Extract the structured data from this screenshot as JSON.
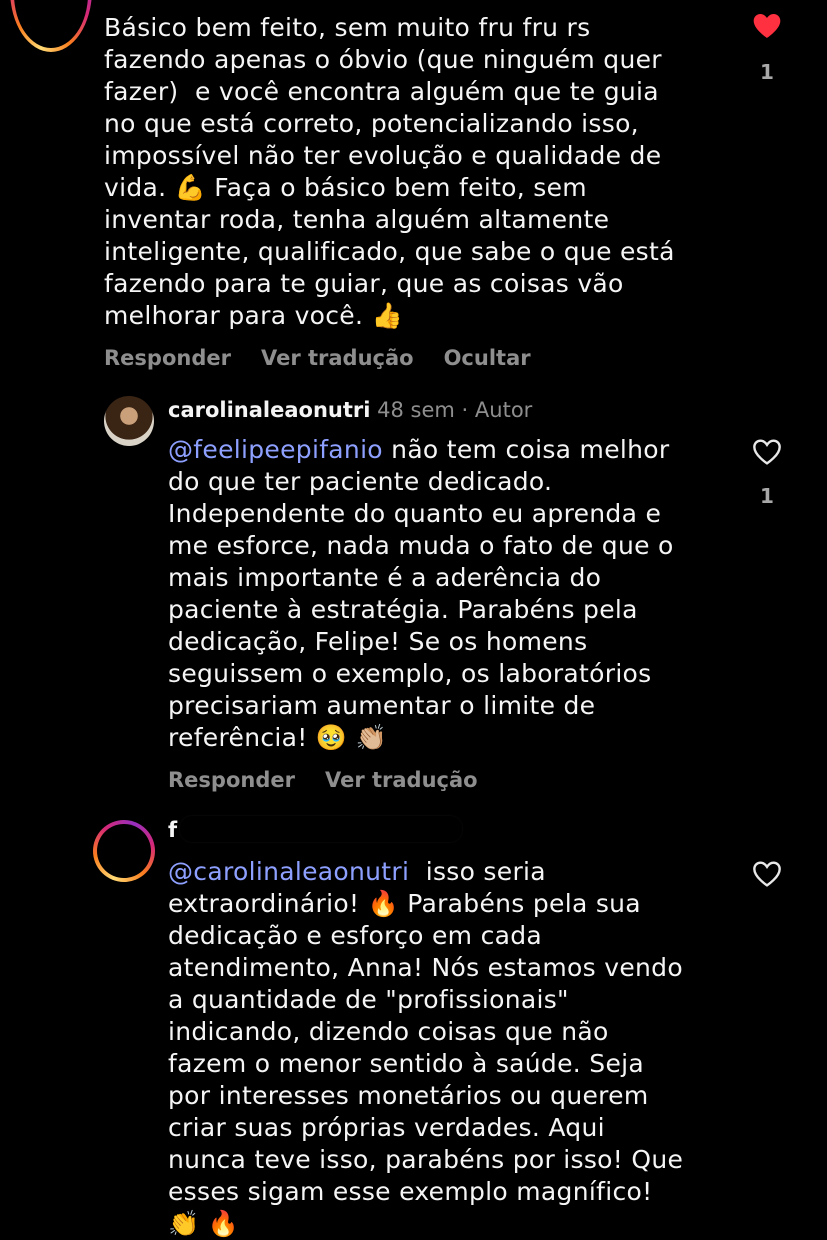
{
  "comments": [
    {
      "text": "Básico bem feito, sem muito fru fru rs\nfazendo apenas o óbvio (que ninguém quer\nfazer)  e você encontra alguém que te guia\nno que está correto, potencializando isso,\nimpossível não ter evolução e qualidade de\nvida. 💪 Faça o básico bem feito, sem\ninventar roda, tenha alguém altamente\ninteligente, qualificado, que sabe o que está\nfazendo para te guiar, que as coisas vão\nmelhorar para você. 👍",
      "liked": true,
      "like_count": "1",
      "actions": [
        "Responder",
        "Ver tradução",
        "Ocultar"
      ]
    },
    {
      "username": "carolinaleaonutri",
      "time": "48 sem",
      "badge": "Autor",
      "mention": "@feelipeepifanio",
      "text": " não tem coisa melhor\ndo que ter paciente dedicado.\nIndependente do quanto eu aprenda e\nme esforce, nada muda o fato de que o\nmais importante é a aderência do\npaciente à estratégia. Parabéns pela\ndedicação, Felipe! Se os homens\nseguissem o exemplo, os laboratórios\nprecisariam aumentar o limite de\nreferência! 🥹 👏🏼",
      "liked": false,
      "like_count": "1",
      "actions": [
        "Responder",
        "Ver tradução"
      ]
    },
    {
      "username": "f",
      "mention": "@carolinaleaonutri",
      "text": "  isso seria\nextraordinário! 🔥 Parabéns pela sua\ndedicação e esforço em cada\natendimento, Anna! Nós estamos vendo\na quantidade de \"profissionais\"\nindicando, dizendo coisas que não\nfazem o menor sentido à saúde. Seja\npor interesses monetários ou querem\ncriar suas próprias verdades. Aqui\nnunca teve isso, parabéns por isso! Que\nesses sigam esse exemplo magnífico!\n👏 🔥",
      "liked": false
    }
  ],
  "colors": {
    "background": "#000000",
    "text": "#f5f5f5",
    "muted": "#8e8e8e",
    "mention": "#8ea0ff",
    "like_red": "#ff3040"
  }
}
